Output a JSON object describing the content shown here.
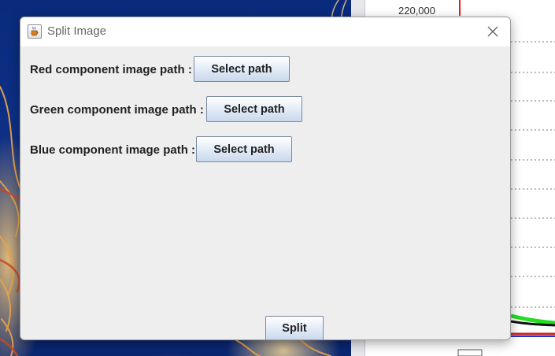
{
  "background_chart": {
    "y_tick_label": "220,000"
  },
  "dialog": {
    "title": "Split Image",
    "rows": [
      {
        "label": "Red component image path :",
        "button": "Select path"
      },
      {
        "label": "Green component image path :",
        "button": "Select path"
      },
      {
        "label": "Blue component image path :",
        "button": "Select path"
      }
    ],
    "split_button": "Split"
  },
  "icons": {
    "app": "java-cup-icon",
    "close": "close-icon"
  },
  "colors": {
    "dialog_bg": "#eeeeee",
    "button_gradient_top": "#ffffff",
    "button_gradient_bottom": "#c8d8ec",
    "button_border": "#7a8aa3",
    "text": "#222222",
    "title_text": "#666666"
  }
}
